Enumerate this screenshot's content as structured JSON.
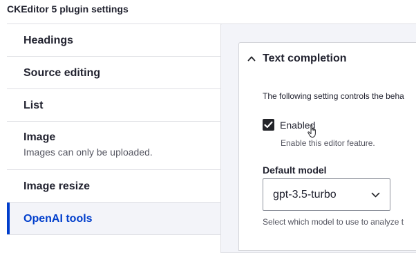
{
  "page": {
    "title": "CKEditor 5 plugin settings"
  },
  "tabs": [
    {
      "label": "Headings",
      "description": ""
    },
    {
      "label": "Source editing",
      "description": ""
    },
    {
      "label": "List",
      "description": ""
    },
    {
      "label": "Image",
      "description": "Images can only be uploaded."
    },
    {
      "label": "Image resize",
      "description": ""
    },
    {
      "label": "OpenAI tools",
      "description": "",
      "active": true
    }
  ],
  "panel": {
    "section_title": "Text completion",
    "help_text": "The following setting controls the beha",
    "enabled": {
      "label": "Enabled",
      "checked": true,
      "description": "Enable this editor feature."
    },
    "default_model": {
      "label": "Default model",
      "value": "gpt-3.5-turbo",
      "description": "Select which model to use to analyze t"
    }
  },
  "colors": {
    "accent": "#003ecc",
    "tab_border": "#dedfe4",
    "panel_bg": "#f3f4f9"
  },
  "icons": {
    "collapse": "chevron-up-icon",
    "select": "chevron-down-icon",
    "check": "check-icon",
    "pointer": "hand-pointer-icon"
  }
}
